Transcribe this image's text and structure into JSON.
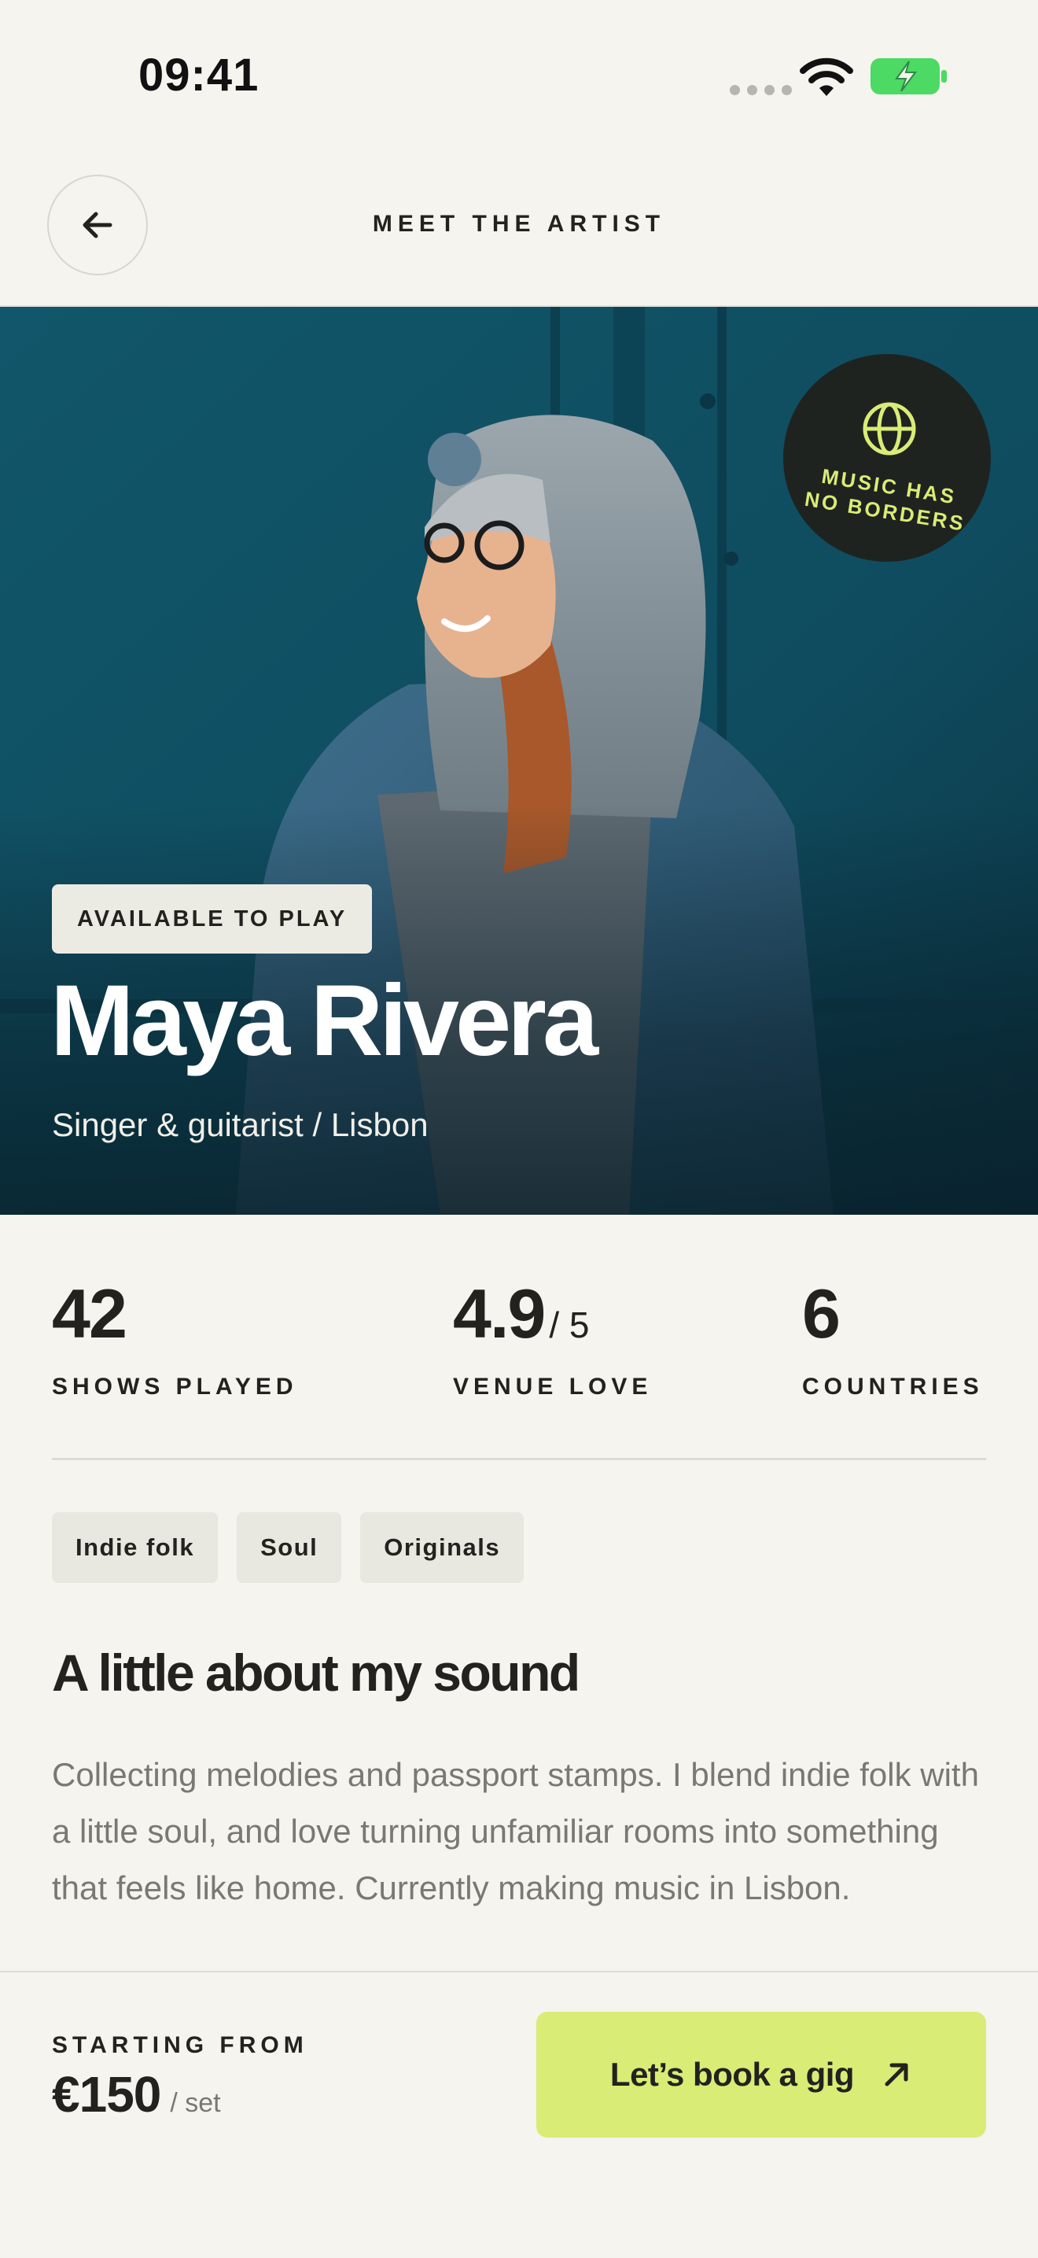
{
  "status_bar": {
    "time": "09:41",
    "icons": [
      "signal-dots-icon",
      "wifi-icon",
      "battery-charging-icon"
    ],
    "battery_color": "#4cd964"
  },
  "header": {
    "title": "MEET THE ARTIST",
    "back_icon": "arrow-left-icon"
  },
  "hero": {
    "badge_text_line1": "MUSIC HAS",
    "badge_text_line2": "NO BORDERS",
    "badge_icon": "globe-icon",
    "availability": "AVAILABLE TO PLAY",
    "name": "Maya Rivera",
    "subtitle": "Singer & guitarist / Lisbon"
  },
  "stats": [
    {
      "value": "42",
      "suffix": "",
      "label": "SHOWS PLAYED"
    },
    {
      "value": "4.9",
      "suffix": "/ 5",
      "label": "VENUE LOVE"
    },
    {
      "value": "6",
      "suffix": "",
      "label": "COUNTRIES"
    }
  ],
  "tags": [
    "Indie folk",
    "Soul",
    "Originals"
  ],
  "about": {
    "heading": "A little about my sound",
    "text": "Collecting melodies and passport stamps. I blend indie folk with a little soul, and love turning unfamiliar rooms into something that feels like home. Currently making music in Lisbon."
  },
  "footer": {
    "price_label": "STARTING FROM",
    "price": "€150",
    "price_unit": "/ set",
    "cta_label": "Let’s book a gig",
    "cta_icon": "arrow-up-right-icon"
  },
  "colors": {
    "background": "#f5f4ef",
    "accent": "#d9ec76",
    "text": "#23221f",
    "badge_bg": "#1f2320"
  }
}
